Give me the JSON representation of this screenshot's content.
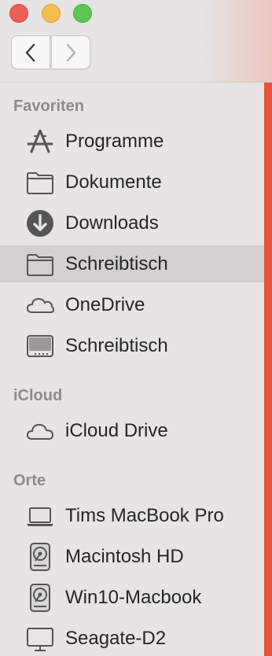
{
  "window": {
    "accent_color": "#e6533a",
    "traffic_lights": {
      "close": "#ec5f57",
      "minimize": "#f4be4f",
      "maximize": "#61c554"
    }
  },
  "toolbar": {
    "back_icon": "chevron-left-icon",
    "forward_icon": "chevron-right-icon"
  },
  "sidebar": {
    "sections": [
      {
        "title": "Favoriten",
        "items": [
          {
            "label": "Programme",
            "icon": "applications-icon"
          },
          {
            "label": "Dokumente",
            "icon": "folder-icon"
          },
          {
            "label": "Downloads",
            "icon": "download-icon"
          },
          {
            "label": "Schreibtisch",
            "icon": "folder-icon",
            "selected": true
          },
          {
            "label": "OneDrive",
            "icon": "cloud-icon"
          },
          {
            "label": "Schreibtisch",
            "icon": "desktop-icon"
          }
        ]
      },
      {
        "title": "iCloud",
        "items": [
          {
            "label": "iCloud Drive",
            "icon": "cloud-icon"
          }
        ]
      },
      {
        "title": "Orte",
        "items": [
          {
            "label": "Tims MacBook Pro",
            "icon": "laptop-icon"
          },
          {
            "label": "Macintosh HD",
            "icon": "hard-drive-icon"
          },
          {
            "label": "Win10-Macbook",
            "icon": "hard-drive-icon"
          },
          {
            "label": "Seagate-D2",
            "icon": "display-icon"
          }
        ]
      }
    ]
  }
}
